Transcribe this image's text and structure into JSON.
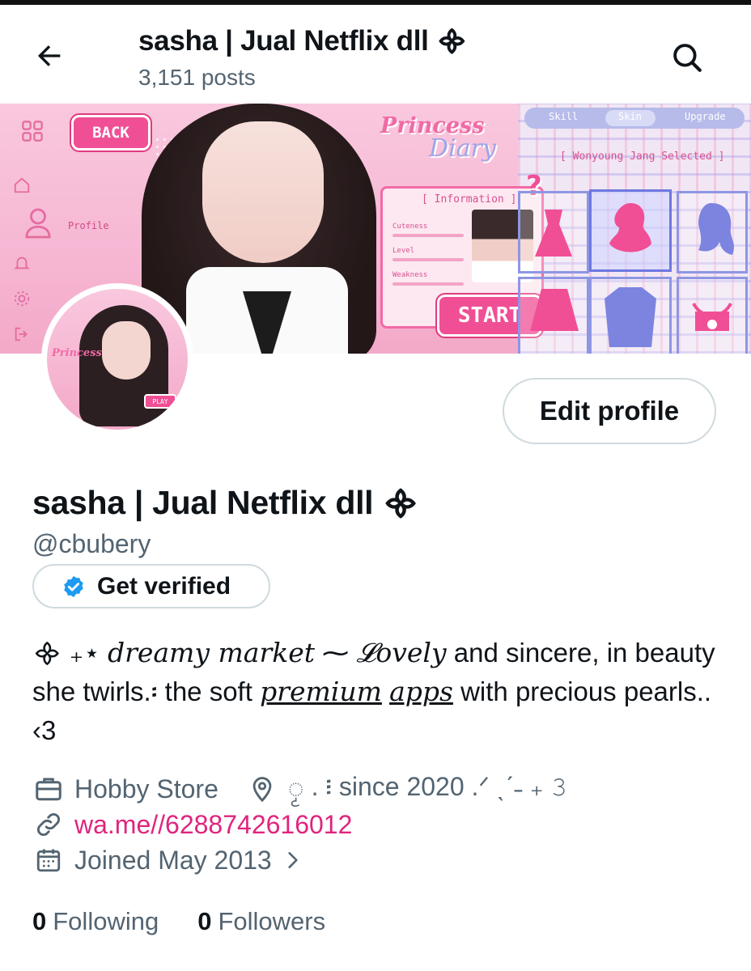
{
  "header": {
    "title": "sasha | Jual Netflix dll ᯽",
    "posts": "3,151 posts"
  },
  "banner": {
    "back_label": "BACK",
    "profile_label": "Profile",
    "princess": "Princess",
    "diary": "Diary",
    "info_title": "[ Information ]",
    "info_rows": [
      "Cuteness",
      "Level",
      "Weakness"
    ],
    "start_label": "START",
    "tabs": [
      "Skill",
      "Skin",
      "Upgrade"
    ],
    "selected": "[ Wonyoung Jang Selected ]",
    "question_mark": "?"
  },
  "avatar": {
    "text": "Princess",
    "play": "PLAY"
  },
  "actions": {
    "edit_profile": "Edit profile",
    "get_verified": "Get verified"
  },
  "profile": {
    "name": "sasha | Jual Netflix dll ᯽",
    "handle": "@cbubery"
  },
  "bio": {
    "lead": "᯽ ₊⋆ ",
    "dreamy": "dreamy market",
    "tilde": " ⁓ ",
    "lovely": "𝓛ovely",
    "part1": " and sincere, in beauty she twirls.፡ the soft ",
    "premium": "premium",
    "apps": "apps",
    "part2": " with precious pearls.. ‹3"
  },
  "meta": {
    "category": "Hobby Store",
    "location": "ၟ . ፧ since 2020 .ᐟ ˎˊ˗ ₊ 𝟹",
    "link": "wa.me//6288742616012",
    "joined": "Joined May 2013"
  },
  "stats": {
    "following_count": "0",
    "following_label": "Following",
    "followers_count": "0",
    "followers_label": "Followers"
  },
  "colors": {
    "accent_link": "#e0247e",
    "verified_blue": "#1d9bf0",
    "muted_text": "#536471"
  }
}
